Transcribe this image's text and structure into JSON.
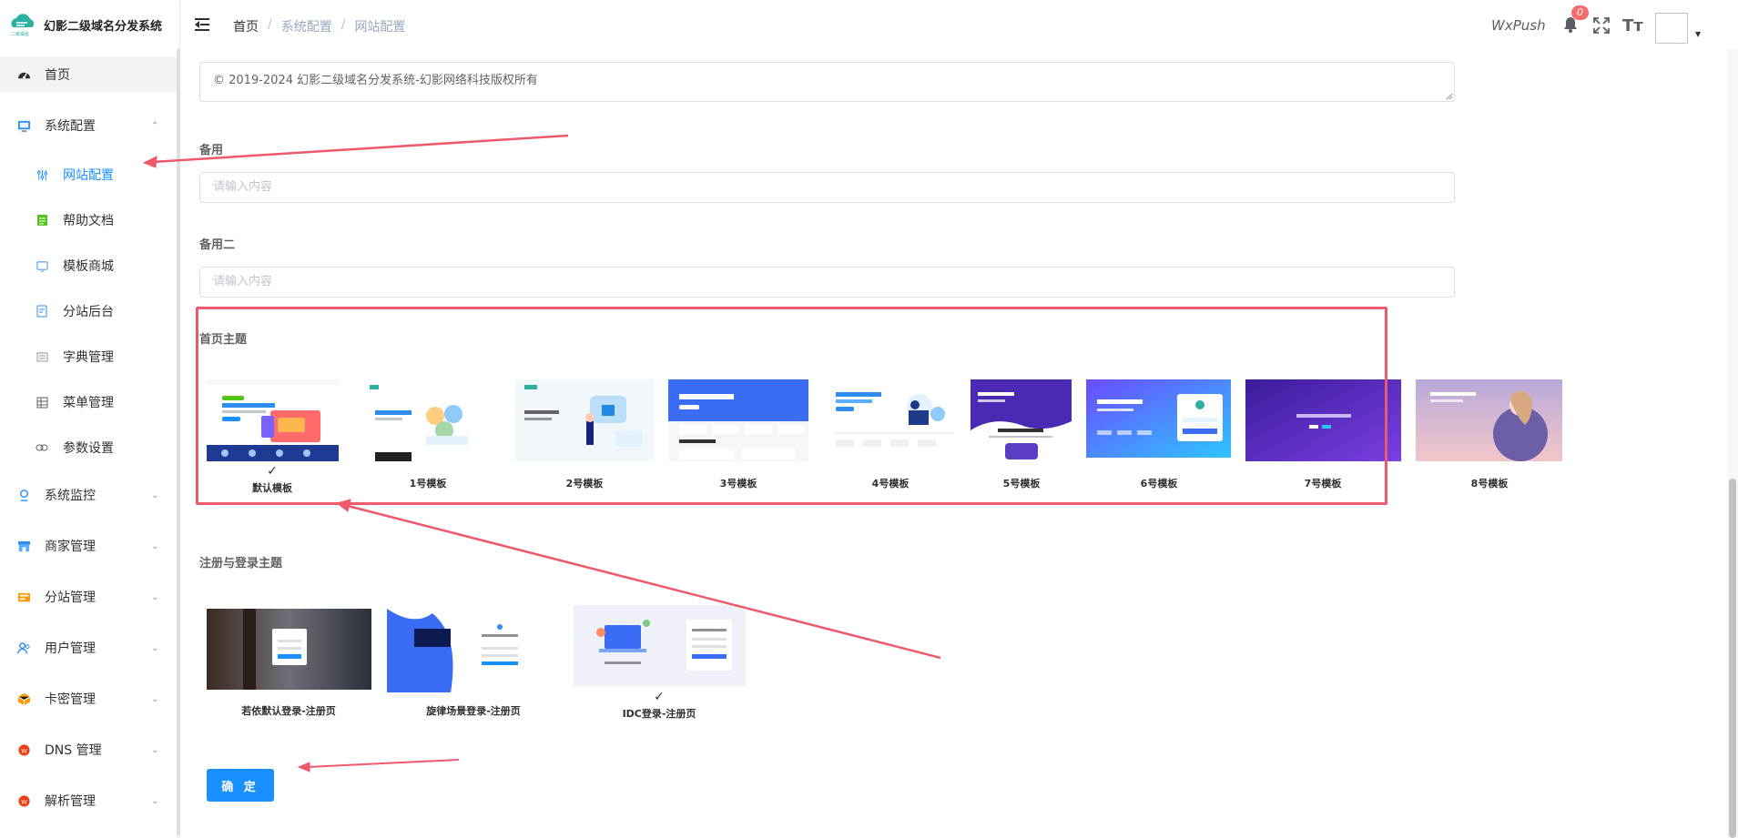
{
  "app": {
    "title": "幻影二级域名分发系统",
    "logo_caption": "二级域名"
  },
  "sidebar": {
    "items": [
      {
        "label": "首页",
        "icon": "dashboard-icon"
      },
      {
        "label": "系统配置",
        "icon": "system-config-icon",
        "expanded": true,
        "children": [
          {
            "label": "网站配置",
            "icon": "settings-sliders-icon",
            "active": true
          },
          {
            "label": "帮助文档",
            "icon": "doc-icon"
          },
          {
            "label": "模板商城",
            "icon": "template-icon"
          },
          {
            "label": "分站后台",
            "icon": "backend-icon"
          },
          {
            "label": "字典管理",
            "icon": "dictionary-icon"
          },
          {
            "label": "菜单管理",
            "icon": "menu-list-icon"
          },
          {
            "label": "参数设置",
            "icon": "link-icon"
          }
        ]
      },
      {
        "label": "系统监控",
        "icon": "monitor-icon"
      },
      {
        "label": "商家管理",
        "icon": "shop-icon"
      },
      {
        "label": "分站管理",
        "icon": "substation-icon"
      },
      {
        "label": "用户管理",
        "icon": "user-icon"
      },
      {
        "label": "卡密管理",
        "icon": "card-key-icon"
      },
      {
        "label": "DNS 管理",
        "icon": "dns-icon"
      },
      {
        "label": "解析管理",
        "icon": "resolve-icon"
      }
    ]
  },
  "header": {
    "breadcrumb": [
      "首页",
      "系统配置",
      "网站配置"
    ],
    "breadcrumb_sep": "/",
    "wxpush": "WxPush",
    "notification_count": "0",
    "size_glyph": "Tт"
  },
  "form": {
    "copyright_value": "© 2019-2024 幻影二级域名分发系统-幻影网络科技版权所有",
    "backup_label": "备用",
    "backup_placeholder": "请输入内容",
    "backup2_label": "备用二",
    "backup2_placeholder": "请输入内容",
    "home_theme_label": "首页主题",
    "home_themes": [
      {
        "label": "默认模板",
        "selected": true
      },
      {
        "label": "1号模板",
        "selected": false
      },
      {
        "label": "2号模板",
        "selected": false
      },
      {
        "label": "3号模板",
        "selected": false
      },
      {
        "label": "4号模板",
        "selected": false
      },
      {
        "label": "5号模板",
        "selected": false
      },
      {
        "label": "6号模板",
        "selected": false
      },
      {
        "label": "7号模板",
        "selected": false
      },
      {
        "label": "8号模板",
        "selected": false
      }
    ],
    "login_theme_label": "注册与登录主题",
    "login_themes": [
      {
        "label": "若依默认登录-注册页",
        "selected": false
      },
      {
        "label": "旋律场景登录-注册页",
        "selected": false
      },
      {
        "label": "IDC登录-注册页",
        "selected": true
      }
    ],
    "confirm_label": "确 定",
    "check_glyph": "✓"
  },
  "colors": {
    "primary": "#1890ff",
    "annotation": "#ee5a6c",
    "badge": "#f56c6c"
  }
}
